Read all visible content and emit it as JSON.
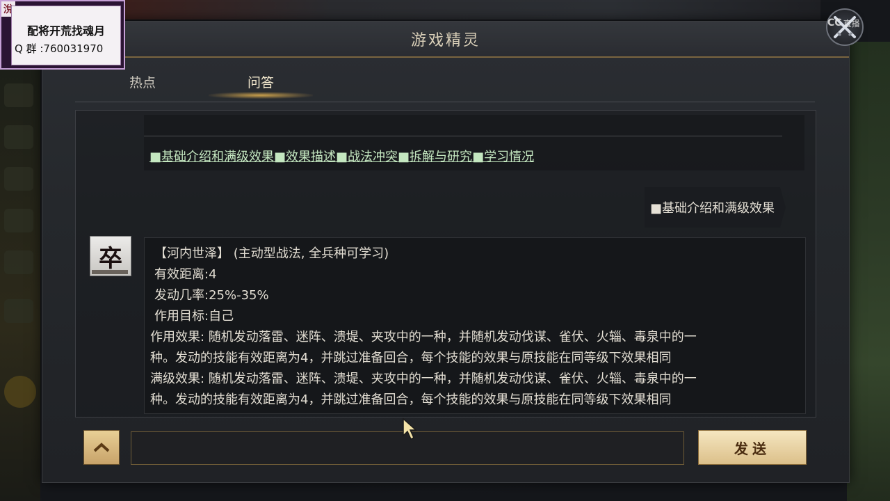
{
  "overlay": {
    "corner_glyph": "涗",
    "title": "配将开荒找魂月",
    "qq_group": "Q 群 :760031970"
  },
  "cc_badge": {
    "logo": "CC",
    "label": "直播"
  },
  "dialog": {
    "title": "游戏精灵"
  },
  "tabs": [
    {
      "label": "热点",
      "active": false
    },
    {
      "label": "问答",
      "active": true
    }
  ],
  "topics": {
    "links": [
      "■基础介绍和满级效果",
      "■效果描述",
      "■战法冲突",
      "■拆解与研究",
      "■学习情况"
    ]
  },
  "user_message": "■基础介绍和满级效果",
  "avatar": {
    "glyph": "卒"
  },
  "answer": {
    "header": "【河内世泽】  (主动型战法, 全兵种可学习)",
    "range": "有效距离:4",
    "chance": "发动几率:25%-35%",
    "target": "作用目标:自己",
    "effect_1": "作用效果: 随机发动落雷、迷阵、溃堤、夹攻中的一种，并随机发动伐谋、雀伏、火辎、毒泉中的一",
    "effect_2": "种。发动的技能有效距离为4，并跳过准备回合，每个技能的效果与原技能在同等级下效果相同",
    "max_1": " 满级效果: 随机发动落雷、迷阵、溃堤、夹攻中的一种，并随机发动伐谋、雀伏、火辎、毒泉中的一",
    "max_2": "种。发动的技能有效距离为4，并跳过准备回合，每个技能的效果与原技能在同等级下效果相同"
  },
  "input": {
    "value": "",
    "placeholder": ""
  },
  "send_label": "发送",
  "colors": {
    "accent": "#e6b450",
    "link": "#c4e7c0",
    "gold_button": "#dcc08a"
  }
}
